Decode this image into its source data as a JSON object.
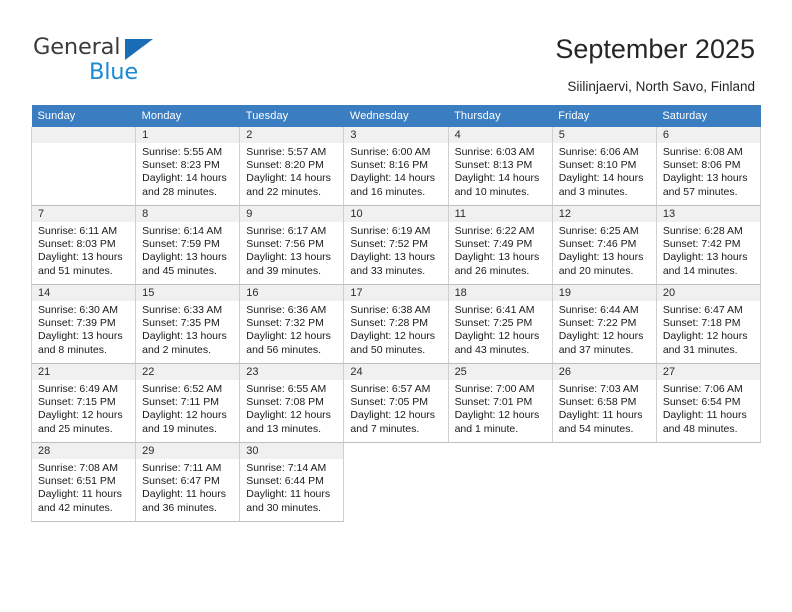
{
  "brand": {
    "name_top": "General",
    "name_bottom": "Blue",
    "accent_dark": "#1a6cb4",
    "accent_light": "#1a8ad4",
    "triangle_icon": "triangle-icon"
  },
  "header": {
    "title": "September 2025",
    "subtitle": "Siilinjaervi, North Savo, Finland"
  },
  "calendar": {
    "header_color": "#3a7dc0",
    "weekdays": [
      "Sunday",
      "Monday",
      "Tuesday",
      "Wednesday",
      "Thursday",
      "Friday",
      "Saturday"
    ],
    "weeks": [
      [
        {
          "day": "",
          "lines": []
        },
        {
          "day": "1",
          "lines": [
            "Sunrise: 5:55 AM",
            "Sunset: 8:23 PM",
            "Daylight: 14 hours",
            "and 28 minutes."
          ]
        },
        {
          "day": "2",
          "lines": [
            "Sunrise: 5:57 AM",
            "Sunset: 8:20 PM",
            "Daylight: 14 hours",
            "and 22 minutes."
          ]
        },
        {
          "day": "3",
          "lines": [
            "Sunrise: 6:00 AM",
            "Sunset: 8:16 PM",
            "Daylight: 14 hours",
            "and 16 minutes."
          ]
        },
        {
          "day": "4",
          "lines": [
            "Sunrise: 6:03 AM",
            "Sunset: 8:13 PM",
            "Daylight: 14 hours",
            "and 10 minutes."
          ]
        },
        {
          "day": "5",
          "lines": [
            "Sunrise: 6:06 AM",
            "Sunset: 8:10 PM",
            "Daylight: 14 hours",
            "and 3 minutes."
          ]
        },
        {
          "day": "6",
          "lines": [
            "Sunrise: 6:08 AM",
            "Sunset: 8:06 PM",
            "Daylight: 13 hours",
            "and 57 minutes."
          ]
        }
      ],
      [
        {
          "day": "7",
          "lines": [
            "Sunrise: 6:11 AM",
            "Sunset: 8:03 PM",
            "Daylight: 13 hours",
            "and 51 minutes."
          ]
        },
        {
          "day": "8",
          "lines": [
            "Sunrise: 6:14 AM",
            "Sunset: 7:59 PM",
            "Daylight: 13 hours",
            "and 45 minutes."
          ]
        },
        {
          "day": "9",
          "lines": [
            "Sunrise: 6:17 AM",
            "Sunset: 7:56 PM",
            "Daylight: 13 hours",
            "and 39 minutes."
          ]
        },
        {
          "day": "10",
          "lines": [
            "Sunrise: 6:19 AM",
            "Sunset: 7:52 PM",
            "Daylight: 13 hours",
            "and 33 minutes."
          ]
        },
        {
          "day": "11",
          "lines": [
            "Sunrise: 6:22 AM",
            "Sunset: 7:49 PM",
            "Daylight: 13 hours",
            "and 26 minutes."
          ]
        },
        {
          "day": "12",
          "lines": [
            "Sunrise: 6:25 AM",
            "Sunset: 7:46 PM",
            "Daylight: 13 hours",
            "and 20 minutes."
          ]
        },
        {
          "day": "13",
          "lines": [
            "Sunrise: 6:28 AM",
            "Sunset: 7:42 PM",
            "Daylight: 13 hours",
            "and 14 minutes."
          ]
        }
      ],
      [
        {
          "day": "14",
          "lines": [
            "Sunrise: 6:30 AM",
            "Sunset: 7:39 PM",
            "Daylight: 13 hours",
            "and 8 minutes."
          ]
        },
        {
          "day": "15",
          "lines": [
            "Sunrise: 6:33 AM",
            "Sunset: 7:35 PM",
            "Daylight: 13 hours",
            "and 2 minutes."
          ]
        },
        {
          "day": "16",
          "lines": [
            "Sunrise: 6:36 AM",
            "Sunset: 7:32 PM",
            "Daylight: 12 hours",
            "and 56 minutes."
          ]
        },
        {
          "day": "17",
          "lines": [
            "Sunrise: 6:38 AM",
            "Sunset: 7:28 PM",
            "Daylight: 12 hours",
            "and 50 minutes."
          ]
        },
        {
          "day": "18",
          "lines": [
            "Sunrise: 6:41 AM",
            "Sunset: 7:25 PM",
            "Daylight: 12 hours",
            "and 43 minutes."
          ]
        },
        {
          "day": "19",
          "lines": [
            "Sunrise: 6:44 AM",
            "Sunset: 7:22 PM",
            "Daylight: 12 hours",
            "and 37 minutes."
          ]
        },
        {
          "day": "20",
          "lines": [
            "Sunrise: 6:47 AM",
            "Sunset: 7:18 PM",
            "Daylight: 12 hours",
            "and 31 minutes."
          ]
        }
      ],
      [
        {
          "day": "21",
          "lines": [
            "Sunrise: 6:49 AM",
            "Sunset: 7:15 PM",
            "Daylight: 12 hours",
            "and 25 minutes."
          ]
        },
        {
          "day": "22",
          "lines": [
            "Sunrise: 6:52 AM",
            "Sunset: 7:11 PM",
            "Daylight: 12 hours",
            "and 19 minutes."
          ]
        },
        {
          "day": "23",
          "lines": [
            "Sunrise: 6:55 AM",
            "Sunset: 7:08 PM",
            "Daylight: 12 hours",
            "and 13 minutes."
          ]
        },
        {
          "day": "24",
          "lines": [
            "Sunrise: 6:57 AM",
            "Sunset: 7:05 PM",
            "Daylight: 12 hours",
            "and 7 minutes."
          ]
        },
        {
          "day": "25",
          "lines": [
            "Sunrise: 7:00 AM",
            "Sunset: 7:01 PM",
            "Daylight: 12 hours",
            "and 1 minute."
          ]
        },
        {
          "day": "26",
          "lines": [
            "Sunrise: 7:03 AM",
            "Sunset: 6:58 PM",
            "Daylight: 11 hours",
            "and 54 minutes."
          ]
        },
        {
          "day": "27",
          "lines": [
            "Sunrise: 7:06 AM",
            "Sunset: 6:54 PM",
            "Daylight: 11 hours",
            "and 48 minutes."
          ]
        }
      ],
      [
        {
          "day": "28",
          "lines": [
            "Sunrise: 7:08 AM",
            "Sunset: 6:51 PM",
            "Daylight: 11 hours",
            "and 42 minutes."
          ]
        },
        {
          "day": "29",
          "lines": [
            "Sunrise: 7:11 AM",
            "Sunset: 6:47 PM",
            "Daylight: 11 hours",
            "and 36 minutes."
          ]
        },
        {
          "day": "30",
          "lines": [
            "Sunrise: 7:14 AM",
            "Sunset: 6:44 PM",
            "Daylight: 11 hours",
            "and 30 minutes."
          ]
        },
        {
          "day": "",
          "lines": []
        },
        {
          "day": "",
          "lines": []
        },
        {
          "day": "",
          "lines": []
        },
        {
          "day": "",
          "lines": []
        }
      ]
    ]
  }
}
